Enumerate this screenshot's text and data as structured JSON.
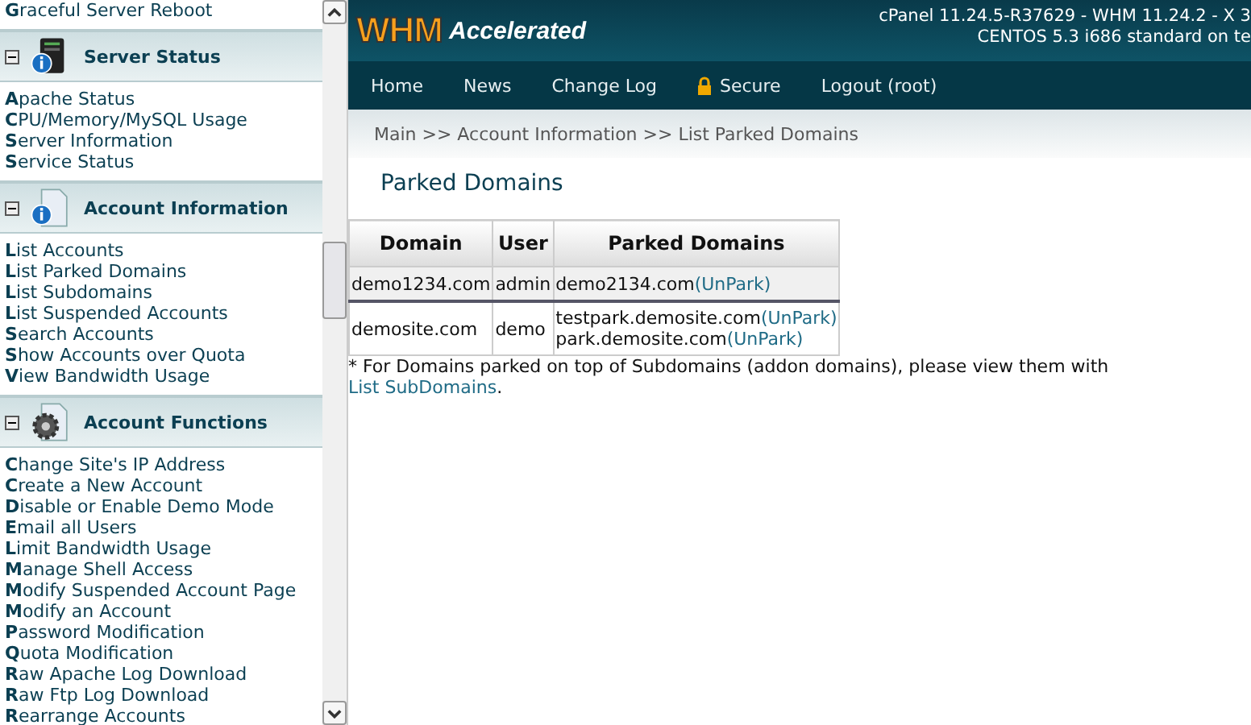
{
  "sidebar": {
    "top_item": "**G**raceful Server Reboot",
    "sections": [
      {
        "title": "Server Status",
        "expanded": true,
        "items": [
          "**A**pache Status",
          "**C**PU/Memory/MySQL Usage",
          "**S**erver Information",
          "**S**ervice Status"
        ]
      },
      {
        "title": "Account Information",
        "expanded": true,
        "items": [
          "**L**ist Accounts",
          "**L**ist Parked Domains",
          "**L**ist Subdomains",
          "**L**ist Suspended Accounts",
          "**S**earch Accounts",
          "**S**how Accounts over Quota",
          "**V**iew Bandwidth Usage"
        ]
      },
      {
        "title": "Account Functions",
        "expanded": true,
        "items": [
          "**C**hange Site's IP Address",
          "**C**reate a New Account",
          "**D**isable or Enable Demo Mode",
          "**E**mail all Users",
          "**L**imit Bandwidth Usage",
          "**M**anage Shell Access",
          "**M**odify Suspended Account Page",
          "**M**odify an Account",
          "**P**assword Modification",
          "**Q**uota Modification",
          "**R**aw Apache Log Download",
          "**R**aw Ftp Log Download",
          "**R**earrange Accounts"
        ]
      }
    ]
  },
  "header": {
    "logo_main": "WHM",
    "logo_sub": "Accelerated",
    "version_lines": [
      "cPanel 11.24.5-R37629 - WHM 11.24.2 - X 3",
      "CENTOS 5.3 i686 standard on te"
    ]
  },
  "nav": [
    {
      "label": "Home",
      "kind": "plain"
    },
    {
      "label": "News",
      "kind": "plain"
    },
    {
      "label": "Change Log",
      "kind": "plain"
    },
    {
      "label": "Secure",
      "kind": "secure"
    },
    {
      "label": "Logout (root)",
      "kind": "plain"
    }
  ],
  "breadcrumb": "Main >> Account Information >> List Parked Domains",
  "page_title": "Parked Domains",
  "table": {
    "columns": [
      "Domain",
      "User",
      "Parked Domains"
    ],
    "rows": [
      {
        "domain": "demo1234.com",
        "user": "admin",
        "parked": [
          {
            "name": "demo2134.com",
            "action": "(UnPark)"
          }
        ]
      },
      {
        "domain": "demosite.com",
        "user": "demo",
        "parked": [
          {
            "name": "testpark.demosite.com",
            "action": "(UnPark)"
          },
          {
            "name": "park.demosite.com",
            "action": "(UnPark)"
          }
        ]
      }
    ]
  },
  "footnote": {
    "text": "* For Domains parked on top of Subdomains (addon domains), please view them with",
    "link": "List SubDomains",
    "after": "."
  }
}
